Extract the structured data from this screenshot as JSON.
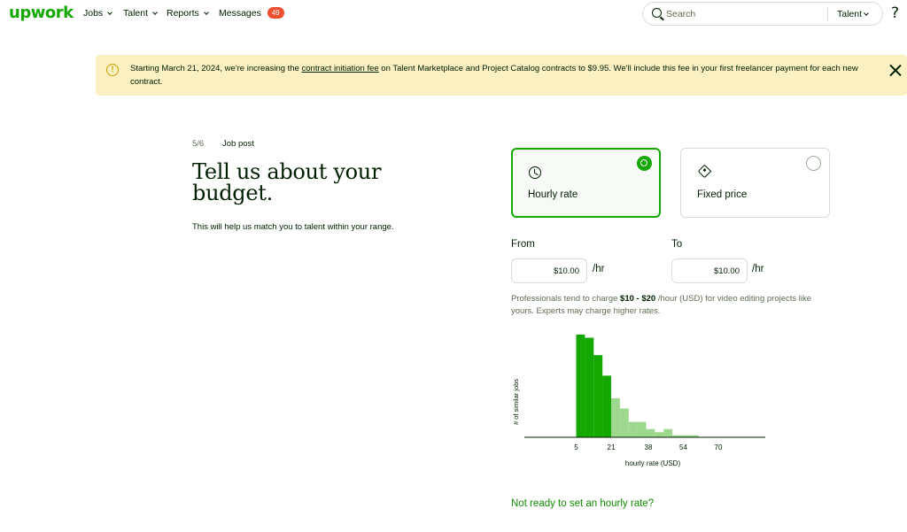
{
  "nav": {
    "logo": "upwork",
    "items": [
      {
        "label": "Jobs"
      },
      {
        "label": "Talent"
      },
      {
        "label": "Reports"
      },
      {
        "label": "Messages",
        "badge": "49"
      }
    ],
    "search_placeholder": "Search",
    "search_scope": "Talent",
    "help": "?"
  },
  "banner": {
    "text_before": "Starting March 21, 2024, we're increasing the ",
    "link": "contract initiation fee",
    "text_after": " on Talent Marketplace and Project Catalog contracts to $9.95. We'll include this fee in your first freelancer payment for each new contract."
  },
  "page": {
    "step": "5/6",
    "step_title": "Job post",
    "heading": "Tell us about your budget.",
    "subtext": "This will help us match you to talent within your range."
  },
  "rate_options": {
    "hourly": {
      "label": "Hourly rate",
      "selected": true
    },
    "fixed": {
      "label": "Fixed price",
      "selected": false
    }
  },
  "range": {
    "from_label": "From",
    "to_label": "To",
    "from_value": "$10.00",
    "to_value": "$10.00",
    "unit": "/hr"
  },
  "hint": {
    "before": "Professionals tend to charge ",
    "range": "$10 - $20",
    "after": " /hour (USD) for video editing projects like yours. Experts may charge higher rates."
  },
  "chart_data": {
    "type": "bar",
    "xlabel": "hourly rate (USD)",
    "ylabel": "# of similar jobs",
    "x_ticks": [
      5,
      21,
      38,
      54,
      70
    ],
    "bin_width": 4,
    "bins": [
      5,
      9,
      13,
      17,
      21,
      25,
      29,
      33,
      37,
      41,
      45,
      49,
      53,
      57,
      61
    ],
    "values": [
      100,
      97,
      80,
      60,
      38,
      28,
      15,
      15,
      8,
      5,
      8,
      2,
      2,
      2,
      0
    ],
    "highlight_range": [
      5,
      21
    ],
    "colors": {
      "highlight": "#14a800",
      "other": "#9ed88f",
      "axis": "#001e00"
    }
  },
  "footer_link": "Not ready to set an hourly rate?"
}
